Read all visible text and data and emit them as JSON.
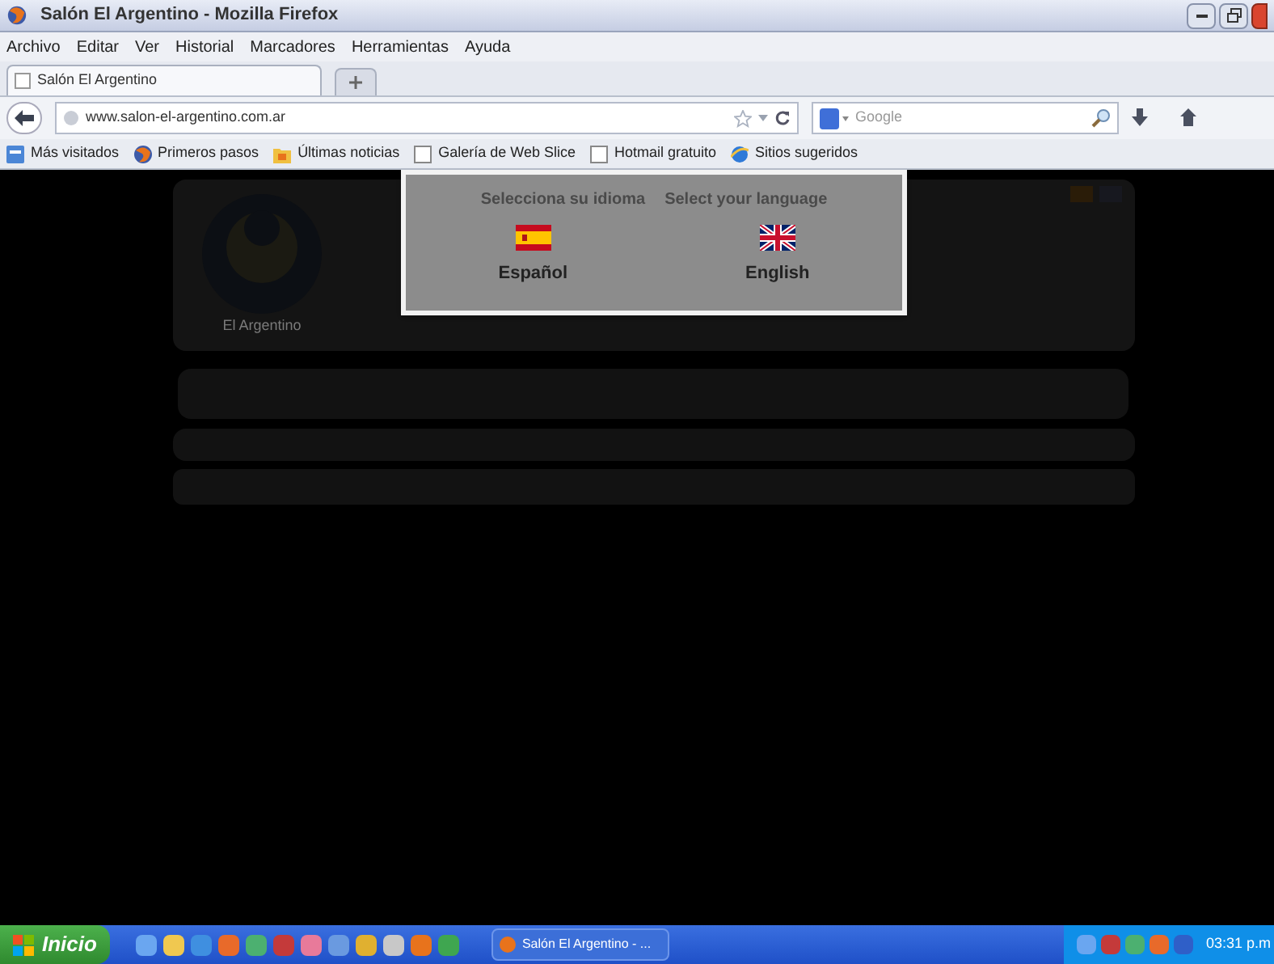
{
  "window": {
    "title": "Salón El Argentino - Mozilla Firefox"
  },
  "menu": [
    "Archivo",
    "Editar",
    "Ver",
    "Historial",
    "Marcadores",
    "Herramientas",
    "Ayuda"
  ],
  "tabs": [
    {
      "label": "Salón El Argentino",
      "selected": true
    }
  ],
  "address": {
    "value": "www.salon-el-argentino.com.ar"
  },
  "search": {
    "placeholder": "Google"
  },
  "bookmarks": [
    {
      "label": "Más visitados",
      "kind": "smart"
    },
    {
      "label": "Primeros pasos",
      "kind": "firefox"
    },
    {
      "label": "Últimas noticias",
      "kind": "feed"
    },
    {
      "label": "Galería de Web Slice",
      "kind": "page"
    },
    {
      "label": "Hotmail gratuito",
      "kind": "page"
    },
    {
      "label": "Sitios sugeridos",
      "kind": "ie"
    }
  ],
  "page": {
    "logo_caption": "El Argentino"
  },
  "language_dialog": {
    "prompts": [
      "Selecciona su idioma",
      "Select your language"
    ],
    "options": [
      {
        "label": "Español",
        "kind": "spanish"
      },
      {
        "label": "English",
        "kind": "british"
      }
    ]
  },
  "taskbar": {
    "start": "Inicio",
    "task": "Salón El Argentino - ...",
    "clock": "03:31 p.m"
  }
}
